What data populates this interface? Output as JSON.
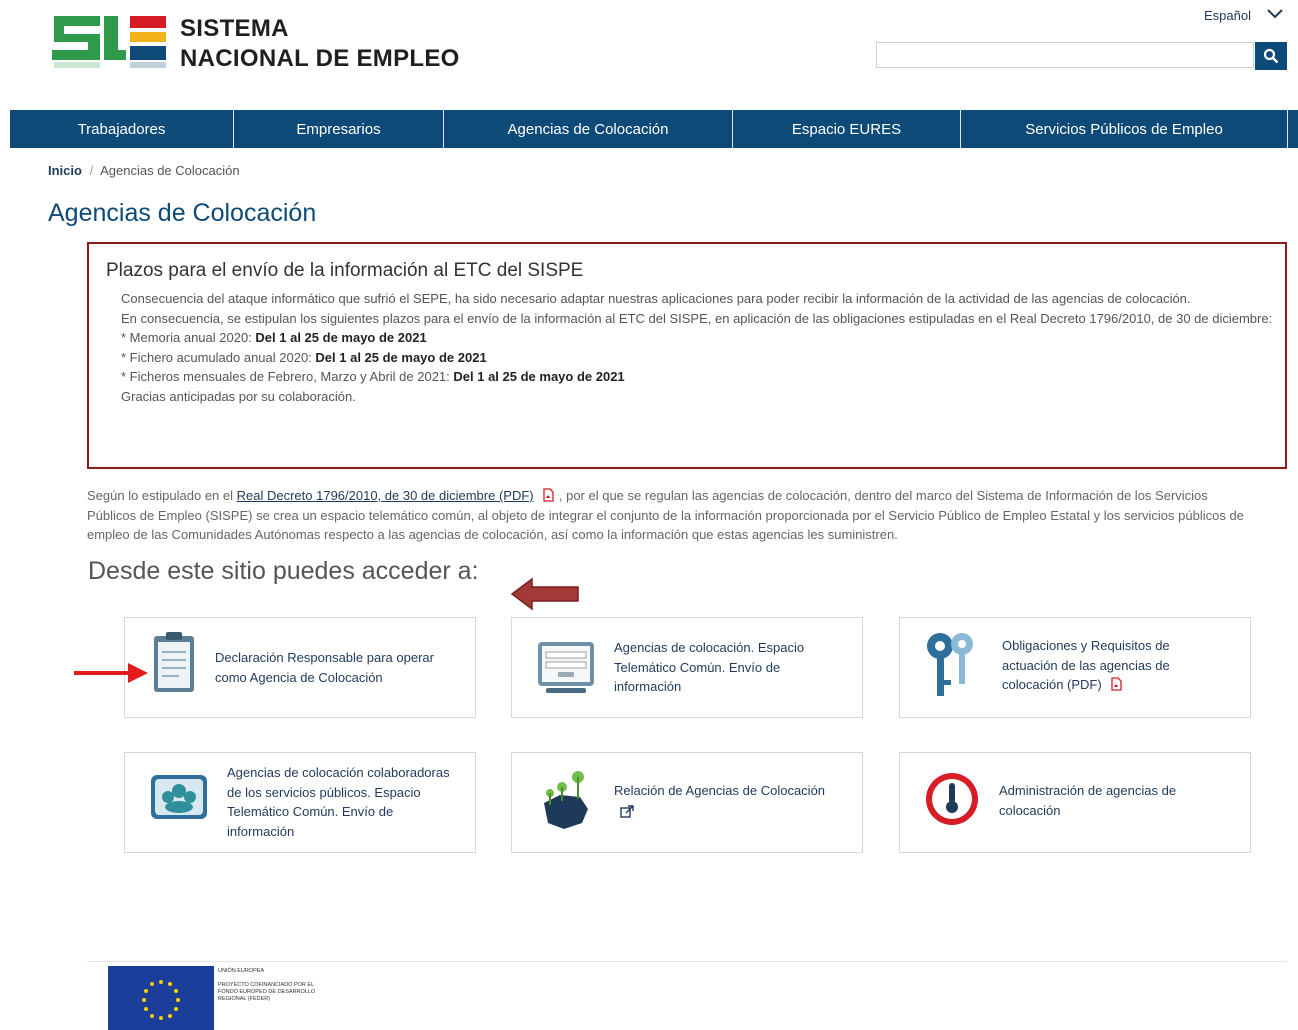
{
  "header": {
    "logo_line1": "SISTEMA",
    "logo_line2": "NACIONAL DE EMPLEO",
    "language": "Español",
    "search": {
      "placeholder": ""
    }
  },
  "nav": [
    "Trabajadores",
    "Empresarios",
    "Agencias de Colocación",
    "Espacio EURES",
    "Servicios Públicos de Empleo"
  ],
  "breadcrumb": {
    "home": "Inicio",
    "separator": "/",
    "current": "Agencias de Colocación"
  },
  "page_title": "Agencias de Colocación",
  "notice": {
    "title": "Plazos para el envío de la información al ETC del SISPE",
    "p1": "Consecuencia del ataque informático que sufrió el SEPE, ha sido necesario adaptar nuestras aplicaciones para poder recibir la información de la actividad de las agencias de colocación.",
    "p2": "En consecuencia, se estipulan los siguientes plazos para el envío de la información al ETC del SISPE, en aplicación de las obligaciones estipuladas en el Real Decreto 1796/2010, de 30 de diciembre:",
    "items": [
      {
        "label": "* Memoria anual 2020: ",
        "value": "Del 1 al 25 de mayo de 2021"
      },
      {
        "label": "* Fichero acumulado anual 2020: ",
        "value": "Del 1 al 25 de mayo de 2021"
      },
      {
        "label": "* Ficheros mensuales de Febrero, Marzo y Abril de 2021: ",
        "value": "Del 1 al 25 de mayo de 2021"
      }
    ],
    "thanks": "Gracias anticipadas por su colaboración."
  },
  "intro": {
    "before": "Según lo estipulado en el ",
    "link": "Real Decreto 1796/2010, de 30 de diciembre (PDF)",
    "after": " , por el que se regulan las agencias de colocación, dentro del marco del Sistema de Información de los Servicios  Públicos de Empleo (SISPE) se crea un espacio telemático común, al objeto de integrar el conjunto de la información proporcionada por el Servicio Público de Empleo Estatal y los servicios públicos de empleo de las Comunidades Autónomas respecto a las agencias de colocación, así como la información que estas agencias les suministren."
  },
  "access_heading": "Desde este sitio puedes acceder a:",
  "cards": [
    {
      "label": "Declaración Responsable para operar como Agencia de Colocación",
      "icon": "clipboard-icon"
    },
    {
      "label": "Agencias de colocación. Espacio Telemático Común. Envío de información",
      "icon": "login-screen-icon"
    },
    {
      "label": "Obligaciones y Requisitos de actuación de las agencias de colocación (PDF)",
      "icon": "keys-icon"
    },
    {
      "label": "Agencias de colocación colaboradoras de los servicios públicos. Espacio Telemático Común. Envío de información",
      "icon": "people-group-icon"
    },
    {
      "label": "Relación de Agencias de Colocación",
      "icon": "spain-map-icon"
    },
    {
      "label": "Administración de agencias de colocación",
      "icon": "thermometer-icon"
    }
  ],
  "footer": {
    "eu_line1": "UNIÓN EUROPEA",
    "eu_line2": "PROYECTO COFINANCIADO POR EL FONDO EUROPEO DE DESARROLLO REGIONAL (FEDER)"
  },
  "colors": {
    "primary": "#0d4a77",
    "notice_border": "#8b1a1a",
    "arrow_red": "#e31b1b",
    "arrow_dark": "#a23a3a"
  }
}
